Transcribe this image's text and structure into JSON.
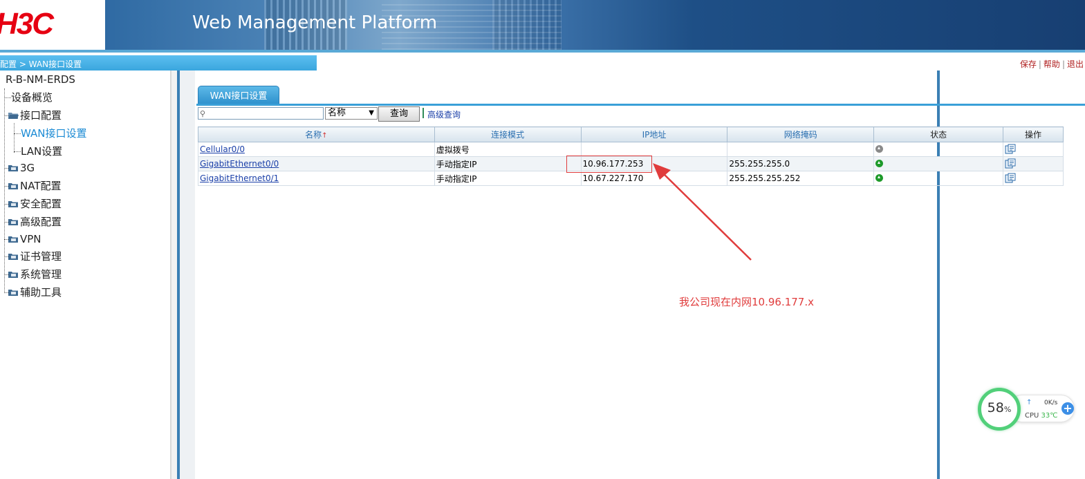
{
  "header": {
    "logo_text": "H3C",
    "title": "Web Management Platform",
    "brand_color": "#e60012"
  },
  "breadcrumb": "配置 > WAN接口设置",
  "top_links": [
    "保存",
    "帮助",
    "退出"
  ],
  "tree": {
    "root": "R-B-NM-ERDS",
    "items": [
      {
        "label": "设备概览",
        "icon": "none"
      },
      {
        "label": "接口配置",
        "icon": "folder-open-icon"
      },
      {
        "label": "WAN接口设置",
        "icon": "none",
        "active": true
      },
      {
        "label": "LAN设置",
        "icon": "none"
      },
      {
        "label": "3G",
        "icon": "folder-closed-icon"
      },
      {
        "label": "NAT配置",
        "icon": "folder-closed-icon"
      },
      {
        "label": "安全配置",
        "icon": "folder-closed-icon"
      },
      {
        "label": "高级配置",
        "icon": "folder-closed-icon"
      },
      {
        "label": "VPN",
        "icon": "folder-closed-icon"
      },
      {
        "label": "证书管理",
        "icon": "folder-closed-icon"
      },
      {
        "label": "系统管理",
        "icon": "folder-closed-icon"
      },
      {
        "label": "辅助工具",
        "icon": "folder-closed-icon"
      }
    ]
  },
  "tab": {
    "label": "WAN接口设置"
  },
  "search": {
    "value": "",
    "select_value": "名称",
    "query_button": "查询",
    "advanced_link": "高级查询"
  },
  "table": {
    "columns": [
      "名称",
      "连接模式",
      "IP地址",
      "网络掩码",
      "状态",
      "操作"
    ],
    "rows": [
      {
        "name": "Cellular0/0",
        "mode": "虚拟拨号",
        "ip": "",
        "mask": "",
        "status": "down"
      },
      {
        "name": "GigabitEthernet0/0",
        "mode": "手动指定IP",
        "ip": "10.96.177.253",
        "mask": "255.255.255.0",
        "status": "up"
      },
      {
        "name": "GigabitEthernet0/1",
        "mode": "手动指定IP",
        "ip": "10.67.227.170",
        "mask": "255.255.255.252",
        "status": "up"
      }
    ]
  },
  "annotation": {
    "text": "我公司现在内网10.96.177.x",
    "color": "#e03c3c"
  },
  "cpu_widget": {
    "percent": "58",
    "percent_unit": "%",
    "net_speed": "0K/s",
    "cpu_label": "CPU",
    "temperature": "33℃",
    "plus": "+"
  }
}
